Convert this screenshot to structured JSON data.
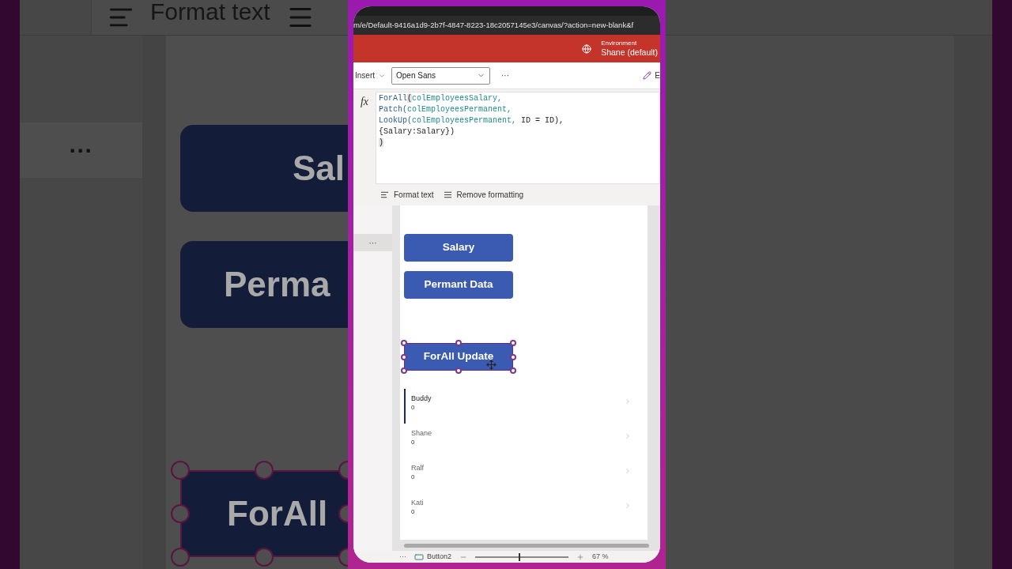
{
  "backdrop": {
    "toolbar_text": "Format text",
    "more": "···",
    "buttons": [
      {
        "label": "Sal",
        "selected": false
      },
      {
        "label": "Perma",
        "selected": false
      },
      {
        "label": "ForAll",
        "selected": true
      }
    ]
  },
  "browser": {
    "url": "m/e/Default-9416a1d9-2b7f-4847-8223-18c2057145e3/canvas/?action=new-blank&f"
  },
  "header": {
    "environment_label": "Environment",
    "environment_name": "Shane (default)"
  },
  "toolbar": {
    "insert": "Insert",
    "font": "Open Sans",
    "more": "···",
    "edit": "E"
  },
  "formula": {
    "fx": "fx",
    "lines": [
      [
        {
          "text": "ForAll",
          "kind": "function"
        },
        {
          "text": "(",
          "kind": "bracket"
        },
        {
          "text": "colEmployeesSalary,",
          "kind": "name"
        }
      ],
      [
        {
          "text": "Patch(",
          "kind": "function"
        },
        {
          "text": "colEmployeesPermanent,",
          "kind": "name"
        }
      ],
      [
        {
          "text": "LookUp(",
          "kind": "function"
        },
        {
          "text": "colEmployeesPermanent,",
          "kind": "name"
        },
        {
          "text": " ID = ID),",
          "kind": "plain"
        }
      ],
      [
        {
          "text": "{Salary:Salary})",
          "kind": "plain"
        }
      ],
      [
        {
          "text": ")",
          "kind": "bracket"
        }
      ]
    ],
    "format_text": "Format text",
    "remove_formatting": "Remove formatting"
  },
  "tree": {
    "more": "···"
  },
  "canvas": {
    "buttons": [
      {
        "label": "Salary",
        "selected": false
      },
      {
        "label": "Permant Data",
        "selected": false
      },
      {
        "label": "ForAll Update",
        "selected": true
      }
    ],
    "gallery": [
      {
        "title": "Buddy",
        "subtitle": "0",
        "selected": true
      },
      {
        "title": "Shane",
        "subtitle": "0",
        "selected": false
      },
      {
        "title": "Ralf",
        "subtitle": "0",
        "selected": false
      },
      {
        "title": "Kati",
        "subtitle": "0",
        "selected": false
      }
    ]
  },
  "status_bar": {
    "more": "···",
    "control": "Button2",
    "zoom_slider": {
      "level": 0.47
    },
    "zoom": "67 %"
  }
}
